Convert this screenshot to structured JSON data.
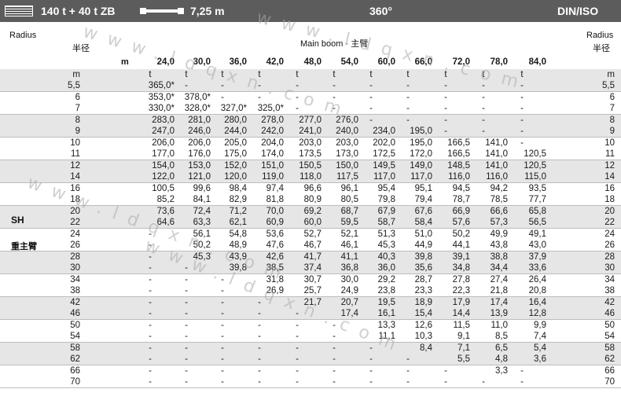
{
  "header": {
    "config": "140 t + 40 t ZB",
    "boom_length": "7,25 m",
    "slew": "360°",
    "standard": "DIN/ISO"
  },
  "table": {
    "radius_en": "Radius",
    "radius_zh": "半径",
    "boom_title": "Main boom · 主臂",
    "boom_unit": "m",
    "boom_lengths": [
      "24,0",
      "30,0",
      "36,0",
      "42,0",
      "48,0",
      "54,0",
      "60,0",
      "66,0",
      "72,0",
      "78,0",
      "84,0"
    ],
    "units_radius": "m",
    "units_load": "t",
    "side_label_sh": "SH",
    "side_label_zh": "重主臂",
    "rows": [
      {
        "r": "5,5",
        "v": [
          "365,0*",
          "-",
          "-",
          "-",
          "-",
          "-",
          "-",
          "-",
          "-",
          "-",
          "-"
        ]
      },
      {
        "r": "6",
        "v": [
          "353,0*",
          "378,0*",
          "-",
          "-",
          "-",
          "-",
          "-",
          "-",
          "-",
          "-",
          "-"
        ]
      },
      {
        "r": "7",
        "v": [
          "330,0*",
          "328,0*",
          "327,0*",
          "325,0*",
          "-",
          "-",
          "-",
          "-",
          "-",
          "-",
          "-"
        ]
      },
      {
        "r": "8",
        "v": [
          "283,0",
          "281,0",
          "280,0",
          "278,0",
          "277,0",
          "276,0",
          "-",
          "-",
          "-",
          "-",
          "-"
        ]
      },
      {
        "r": "9",
        "v": [
          "247,0",
          "246,0",
          "244,0",
          "242,0",
          "241,0",
          "240,0",
          "234,0",
          "195,0",
          "-",
          "-",
          "-"
        ]
      },
      {
        "r": "10",
        "v": [
          "206,0",
          "206,0",
          "205,0",
          "204,0",
          "203,0",
          "203,0",
          "202,0",
          "195,0",
          "166,5",
          "141,0",
          "-"
        ]
      },
      {
        "r": "11",
        "v": [
          "177,0",
          "176,0",
          "175,0",
          "174,0",
          "173,5",
          "173,0",
          "172,5",
          "172,0",
          "166,5",
          "141,0",
          "120,5"
        ]
      },
      {
        "r": "12",
        "v": [
          "154,0",
          "153,0",
          "152,0",
          "151,0",
          "150,5",
          "150,0",
          "149,5",
          "149,0",
          "148,5",
          "141,0",
          "120,5"
        ]
      },
      {
        "r": "14",
        "v": [
          "122,0",
          "121,0",
          "120,0",
          "119,0",
          "118,0",
          "117,5",
          "117,0",
          "117,0",
          "116,0",
          "116,0",
          "115,0"
        ]
      },
      {
        "r": "16",
        "v": [
          "100,5",
          "99,6",
          "98,4",
          "97,4",
          "96,6",
          "96,1",
          "95,4",
          "95,1",
          "94,5",
          "94,2",
          "93,5"
        ]
      },
      {
        "r": "18",
        "v": [
          "85,2",
          "84,1",
          "82,9",
          "81,8",
          "80,9",
          "80,5",
          "79,8",
          "79,4",
          "78,7",
          "78,5",
          "77,7"
        ]
      },
      {
        "r": "20",
        "v": [
          "73,6",
          "72,4",
          "71,2",
          "70,0",
          "69,2",
          "68,7",
          "67,9",
          "67,6",
          "66,9",
          "66,6",
          "65,8"
        ]
      },
      {
        "r": "22",
        "v": [
          "64,6",
          "63,3",
          "62,1",
          "60,9",
          "60,0",
          "59,5",
          "58,7",
          "58,4",
          "57,6",
          "57,3",
          "56,5"
        ]
      },
      {
        "r": "24",
        "v": [
          "-",
          "56,1",
          "54,8",
          "53,6",
          "52,7",
          "52,1",
          "51,3",
          "51,0",
          "50,2",
          "49,9",
          "49,1"
        ]
      },
      {
        "r": "26",
        "v": [
          "-",
          "50,2",
          "48,9",
          "47,6",
          "46,7",
          "46,1",
          "45,3",
          "44,9",
          "44,1",
          "43,8",
          "43,0"
        ]
      },
      {
        "r": "28",
        "v": [
          "-",
          "45,3",
          "43,9",
          "42,6",
          "41,7",
          "41,1",
          "40,3",
          "39,8",
          "39,1",
          "38,8",
          "37,9"
        ]
      },
      {
        "r": "30",
        "v": [
          "-",
          "-",
          "39,8",
          "38,5",
          "37,4",
          "36,8",
          "36,0",
          "35,6",
          "34,8",
          "34,4",
          "33,6"
        ]
      },
      {
        "r": "34",
        "v": [
          "-",
          "-",
          "-",
          "31,8",
          "30,7",
          "30,0",
          "29,2",
          "28,7",
          "27,8",
          "27,4",
          "26,4"
        ]
      },
      {
        "r": "38",
        "v": [
          "-",
          "-",
          "-",
          "26,9",
          "25,7",
          "24,9",
          "23,8",
          "23,3",
          "22,3",
          "21,8",
          "20,8"
        ]
      },
      {
        "r": "42",
        "v": [
          "-",
          "-",
          "-",
          "-",
          "21,7",
          "20,7",
          "19,5",
          "18,9",
          "17,9",
          "17,4",
          "16,4"
        ]
      },
      {
        "r": "46",
        "v": [
          "-",
          "-",
          "-",
          "-",
          "-",
          "17,4",
          "16,1",
          "15,4",
          "14,4",
          "13,9",
          "12,8"
        ]
      },
      {
        "r": "50",
        "v": [
          "-",
          "-",
          "-",
          "-",
          "-",
          "-",
          "13,3",
          "12,6",
          "11,5",
          "11,0",
          "9,9"
        ]
      },
      {
        "r": "54",
        "v": [
          "-",
          "-",
          "-",
          "-",
          "-",
          "-",
          "11,1",
          "10,3",
          "9,1",
          "8,5",
          "7,4"
        ]
      },
      {
        "r": "58",
        "v": [
          "-",
          "-",
          "-",
          "-",
          "-",
          "-",
          "-",
          "8,4",
          "7,1",
          "6,5",
          "5,4"
        ]
      },
      {
        "r": "62",
        "v": [
          "-",
          "-",
          "-",
          "-",
          "-",
          "-",
          "-",
          "-",
          "5,5",
          "4,8",
          "3,6"
        ]
      },
      {
        "r": "66",
        "v": [
          "-",
          "-",
          "-",
          "-",
          "-",
          "-",
          "-",
          "-",
          "-",
          "3,3",
          "-"
        ]
      },
      {
        "r": "70",
        "v": [
          "-",
          "-",
          "-",
          "-",
          "-",
          "-",
          "-",
          "-",
          "-",
          "-",
          "-"
        ]
      }
    ]
  },
  "watermark": "www.ldqxn.com"
}
